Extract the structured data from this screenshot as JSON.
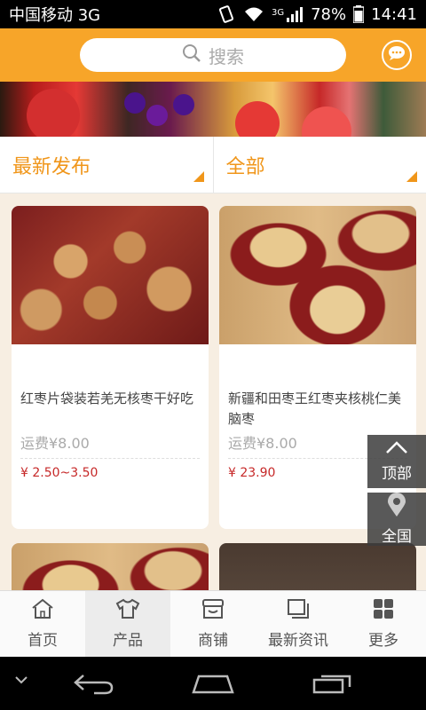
{
  "status_bar": {
    "carrier": "中国移动 3G",
    "network_label": "3G",
    "battery": "78%",
    "time": "14:41"
  },
  "header": {
    "search_placeholder": "搜索",
    "accent_color": "#f7a529"
  },
  "filters": {
    "sort_label": "最新发布",
    "category_label": "全部"
  },
  "products": [
    {
      "name": "红枣片袋装若羌无核枣干好吃",
      "shipping": "运费¥8.00",
      "price": "¥ 2.50~3.50",
      "image": "dried-jujube-slices"
    },
    {
      "name": "新疆和田枣王红枣夹核桃仁美脑枣",
      "shipping": "运费¥8.00",
      "price": "¥ 23.90",
      "image": "jujube-with-walnut"
    },
    {
      "image": "jujube-with-walnut"
    },
    {
      "image": "red-dates"
    }
  ],
  "float_buttons": {
    "top_label": "顶部",
    "region_label": "全国"
  },
  "tabs": [
    {
      "label": "首页",
      "icon": "home-icon"
    },
    {
      "label": "产品",
      "icon": "shirt-icon",
      "active": true
    },
    {
      "label": "商铺",
      "icon": "shop-icon"
    },
    {
      "label": "最新资讯",
      "icon": "news-icon"
    },
    {
      "label": "更多",
      "icon": "grid-icon"
    }
  ]
}
